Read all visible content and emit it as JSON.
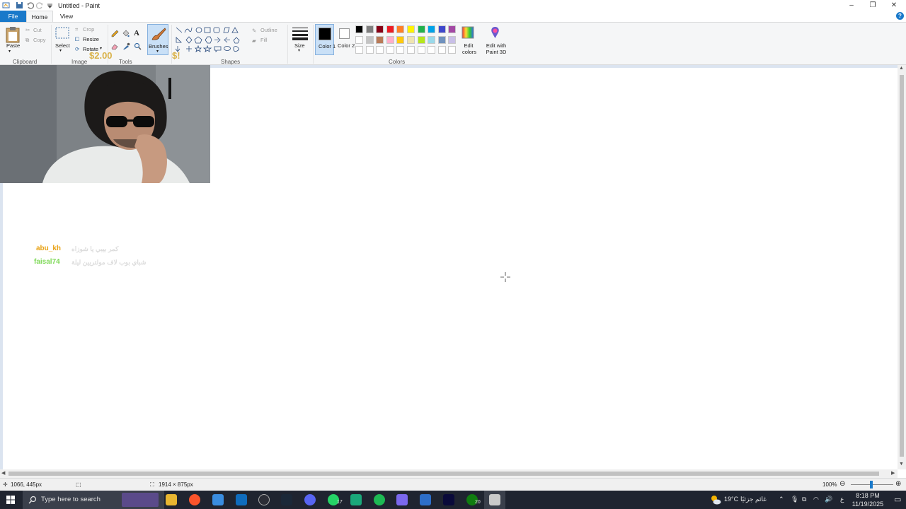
{
  "window": {
    "title": "Untitled - Paint",
    "minimize": "–",
    "restore": "❐",
    "close": "✕"
  },
  "tabs": {
    "file": "File",
    "home": "Home",
    "view": "View",
    "help": "?"
  },
  "ribbon": {
    "clipboard": {
      "label": "Clipboard",
      "paste": "Paste",
      "cut": "Cut",
      "copy": "Copy"
    },
    "image": {
      "label": "Image",
      "select": "Select",
      "crop": "Crop",
      "resize": "Resize",
      "rotate": "Rotate"
    },
    "tools": {
      "label": "Tools"
    },
    "brushes": {
      "label": "Brushes"
    },
    "shapes": {
      "label": "Shapes",
      "outline": "Outline",
      "fill": "Fill"
    },
    "size": {
      "label": "Size"
    },
    "colors": {
      "label": "Colors",
      "color1": "Color 1",
      "color2": "Color 2",
      "edit_colors": "Edit colors",
      "edit_paint3d": "Edit with Paint 3D",
      "active_color1": "#000000",
      "active_color2": "#ffffff",
      "palette_row1": [
        "#000000",
        "#7f7f7f",
        "#880015",
        "#ed1c24",
        "#ff7f27",
        "#fff200",
        "#22b14c",
        "#00a2e8",
        "#3f48cc",
        "#a349a4"
      ],
      "palette_row2": [
        "#ffffff",
        "#c3c3c3",
        "#b97a57",
        "#ffaec9",
        "#ffc90e",
        "#efe4b0",
        "#b5e61d",
        "#99d9ea",
        "#7092be",
        "#c8bfe7"
      ],
      "palette_row3": [
        "#ffffff",
        "#ffffff",
        "#ffffff",
        "#ffffff",
        "#ffffff",
        "#ffffff",
        "#ffffff",
        "#ffffff",
        "#ffffff",
        "#ffffff"
      ]
    }
  },
  "overlay": {
    "donation_amount": "$2.00",
    "donation_extra": "$!",
    "chat": [
      {
        "user": "abu_kh",
        "message": "كمر بيبي يا شوزاه",
        "color": "#e8a317"
      },
      {
        "user": "faisal74",
        "message": "شباي بوب لاف مولتريين ليلة",
        "color": "#7ed957"
      }
    ]
  },
  "status": {
    "cursor_pos": "1066, 445px",
    "canvas_size": "1914 × 875px",
    "zoom": "100%"
  },
  "taskbar": {
    "search_placeholder": "Type here to search",
    "weather": "19°C",
    "weather_text": "غائم جزئيًا",
    "lang": "ع",
    "time": "8:18 PM",
    "date": "11/19/2025",
    "whatsapp_badge": "17",
    "xbox_badge": "20"
  }
}
